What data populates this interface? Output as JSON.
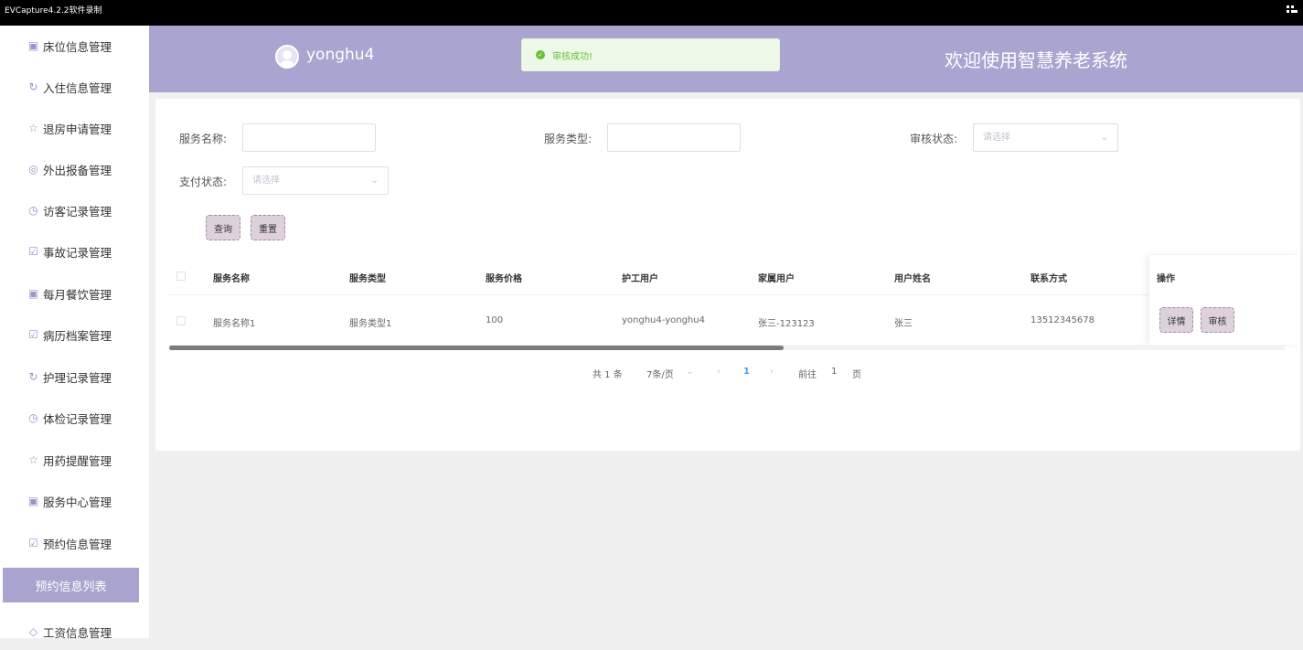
{
  "window": {
    "title": "EVCapture4.2.2软件录制"
  },
  "sidebar": {
    "items": [
      {
        "label": "床位信息管理",
        "icon": "gift-icon"
      },
      {
        "label": "入住信息管理",
        "icon": "refresh-icon"
      },
      {
        "label": "退房申请管理",
        "icon": "star-icon"
      },
      {
        "label": "外出报备管理",
        "icon": "compass-icon"
      },
      {
        "label": "访客记录管理",
        "icon": "timer-icon"
      },
      {
        "label": "事故记录管理",
        "icon": "calendar-check-icon"
      },
      {
        "label": "每月餐饮管理",
        "icon": "gift-icon"
      },
      {
        "label": "病历档案管理",
        "icon": "calendar-check-icon"
      },
      {
        "label": "护理记录管理",
        "icon": "refresh-icon"
      },
      {
        "label": "体检记录管理",
        "icon": "timer-icon"
      },
      {
        "label": "用药提醒管理",
        "icon": "star-icon"
      },
      {
        "label": "服务中心管理",
        "icon": "gift-icon"
      },
      {
        "label": "预约信息管理",
        "icon": "calendar-check-icon"
      },
      {
        "label": "工资信息管理",
        "icon": "diamond-icon"
      }
    ],
    "active_sub": "预约信息列表"
  },
  "header": {
    "username": "yonghu4",
    "toast": "审核成功!",
    "site_title": "欢迎使用智慧养老系统"
  },
  "filters": {
    "service_name_label": "服务名称:",
    "service_type_label": "服务类型:",
    "audit_status_label": "审核状态:",
    "audit_status_placeholder": "请选择",
    "pay_status_label": "支付状态:",
    "pay_status_placeholder": "请选择",
    "search_button": "查询",
    "reset_button": "重置"
  },
  "table": {
    "columns": [
      "服务名称",
      "服务类型",
      "服务价格",
      "护工用户",
      "家属用户",
      "用户姓名",
      "联系方式",
      "操作"
    ],
    "rows": [
      {
        "name": "服务名称1",
        "type": "服务类型1",
        "price": "100",
        "nurse": "yonghu4-yonghu4",
        "family": "张三-123123",
        "user_name": "张三",
        "phone": "13512345678"
      }
    ],
    "detail_button": "详情",
    "audit_button": "审核"
  },
  "pagination": {
    "total": "共 1 条",
    "page_size": "7条/页",
    "current": "1",
    "goto_label": "前往",
    "goto_value": "1",
    "page_unit": "页"
  },
  "colors": {
    "header": "#aaa5d0",
    "sidebar_active": "#a9a4cf",
    "success": "#67c23a"
  }
}
